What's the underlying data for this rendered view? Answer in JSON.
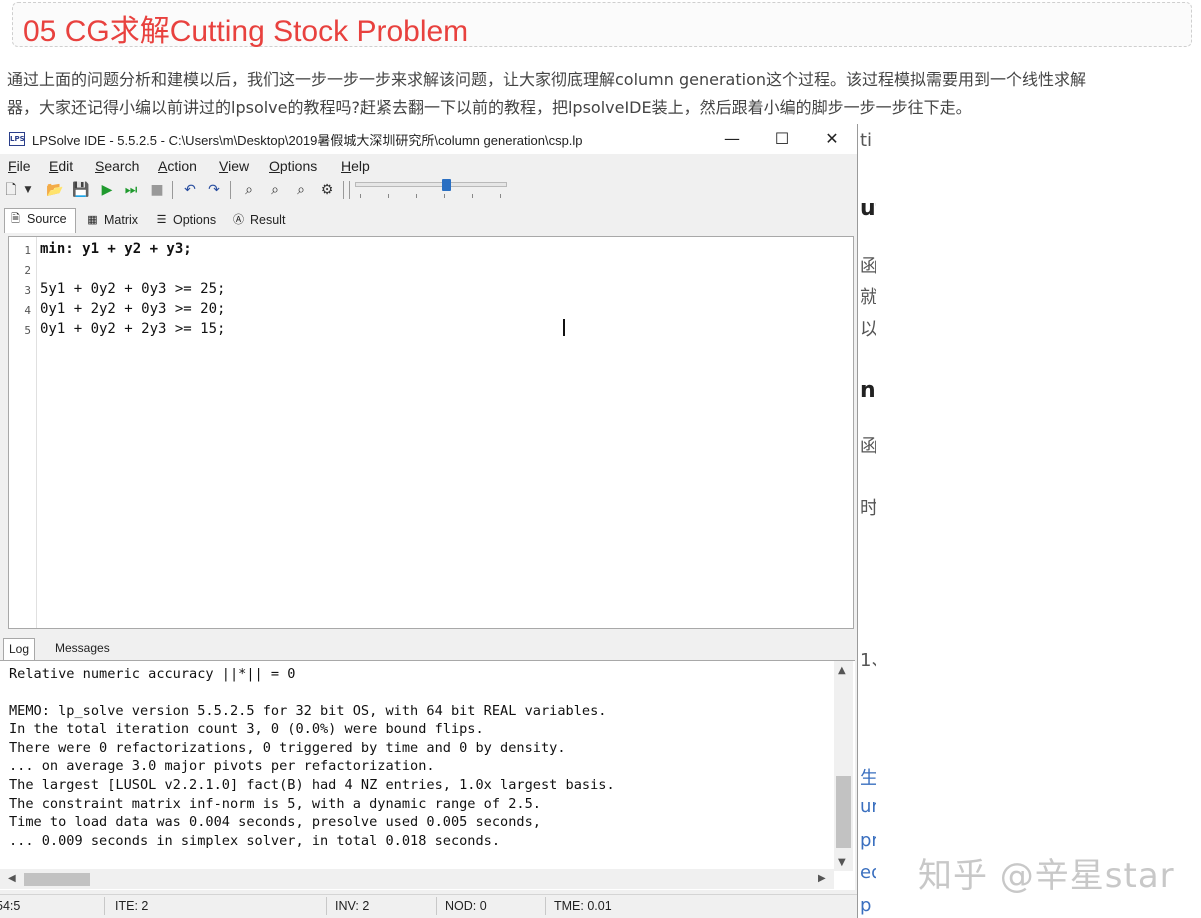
{
  "article": {
    "heading": "05 CG求解Cutting Stock Problem",
    "paragraph_line1": "通过上面的问题分析和建模以后，我们这一步一步一步来求解该问题，让大家彻底理解column generation这个过程。该过程模拟需要用到一个线性求解",
    "paragraph_line2": "器，大家还记得小编以前讲过的lpsolve的教程吗?赶紧去翻一下以前的教程，把lpsolveIDE装上，然后跟着小编的脚步一步一步往下走。",
    "watermark": "知乎 @辛星star",
    "bg_fragments": [
      "ti",
      "ut",
      "函",
      "就",
      "以",
      "n",
      "函",
      "时",
      "1、",
      "生",
      "ur",
      "pr",
      "ed",
      "p"
    ]
  },
  "window": {
    "title": "LPSolve IDE - 5.5.2.5 - C:\\Users\\m\\Desktop\\2019暑假城大深圳研究所\\column generation\\csp.lp",
    "icon_text": "LPS",
    "controls": {
      "minimize": "—",
      "maximize": "☐",
      "close": "✕"
    },
    "menu": [
      "File",
      "Edit",
      "Search",
      "Action",
      "View",
      "Options",
      "Help"
    ],
    "toolbar_icons": [
      "new-file-icon",
      "open-folder-icon",
      "save-icon",
      "run-icon",
      "step-icon",
      "stop-icon",
      "undo-icon",
      "redo-icon",
      "find-icon",
      "find-next-icon",
      "replace-icon",
      "settings-icon"
    ],
    "tabs": [
      "Source",
      "Matrix",
      "Options",
      "Result"
    ],
    "active_tab": "Source"
  },
  "editor": {
    "lines": [
      {
        "no": "1",
        "text": "min: y1 + y2 + y3;"
      },
      {
        "no": "2",
        "text": ""
      },
      {
        "no": "3",
        "text": "5y1 + 0y2 + 0y3 >= 25;"
      },
      {
        "no": "4",
        "text": "0y1 + 2y2 + 0y3 >= 20;"
      },
      {
        "no": "5",
        "text": "0y1 + 0y2 + 2y3 >= 15;"
      }
    ]
  },
  "log": {
    "tabs": [
      "Log",
      "Messages"
    ],
    "lines": [
      "Relative numeric accuracy ||*|| = 0",
      "",
      "MEMO: lp_solve version 5.5.2.5 for 32 bit OS, with 64 bit REAL variables.",
      "In the total iteration count 3, 0 (0.0%) were bound flips.",
      "There were 0 refactorizations, 0 triggered by time and 0 by density.",
      "... on average 3.0 major pivots per refactorization.",
      "The largest [LUSOL v2.2.1.0] fact(B) had 4 NZ entries, 1.0x largest basis.",
      "The constraint matrix inf-norm is 5, with a dynamic range of 2.5.",
      "Time to load data was 0.004 seconds, presolve used 0.005 seconds,",
      "... 0.009 seconds in simplex solver, in total 0.018 seconds."
    ]
  },
  "status": {
    "position": "54:5",
    "ite": "ITE: 2",
    "inv": "INV: 2",
    "nod": "NOD: 0",
    "tme": "TME: 0.01"
  }
}
